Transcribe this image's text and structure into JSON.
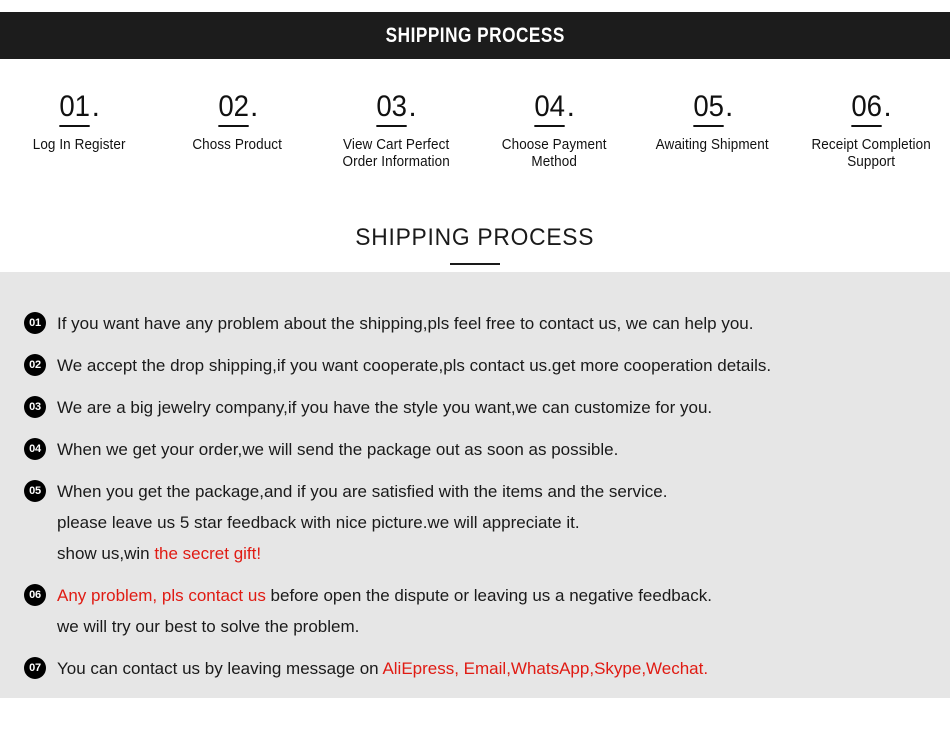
{
  "banner": {
    "title": "SHIPPING PROCESS"
  },
  "steps": [
    {
      "num": "01",
      "dot": ".",
      "label": "Log In Register"
    },
    {
      "num": "02",
      "dot": ".",
      "label": "Choss Product"
    },
    {
      "num": "03",
      "dot": ".",
      "label": "View Cart Perfect\nOrder Information"
    },
    {
      "num": "04",
      "dot": ".",
      "label": "Choose Payment\nMethod"
    },
    {
      "num": "05",
      "dot": ".",
      "label": "Awaiting Shipment"
    },
    {
      "num": "06",
      "dot": ".",
      "label": "Receipt Completion\nSupport"
    }
  ],
  "section": {
    "title": "SHIPPING PROCESS"
  },
  "colors": {
    "banner_bg": "#1c1c1c",
    "panel_bg": "#e6e6e6",
    "accent_red": "#e01b13",
    "badge_bg": "#000000",
    "text": "#1a1a1a"
  },
  "faq": [
    {
      "badge": "01",
      "lines": [
        [
          {
            "t": "If you want have any problem about the shipping,pls feel free to contact us, we can help you.",
            "c": "black"
          }
        ]
      ]
    },
    {
      "badge": "02",
      "lines": [
        [
          {
            "t": "We accept the drop shipping,if you want cooperate,pls contact us.get more cooperation details.",
            "c": "black"
          }
        ]
      ]
    },
    {
      "badge": "03",
      "lines": [
        [
          {
            "t": "We are a big jewelry company,if you have the style you want,we can customize for you.",
            "c": "black"
          }
        ]
      ]
    },
    {
      "badge": "04",
      "lines": [
        [
          {
            "t": "When we get your order,we will send the package out as soon as possible.",
            "c": "black"
          }
        ]
      ]
    },
    {
      "badge": "05",
      "lines": [
        [
          {
            "t": "When you get the package,and if you are satisfied with the items and the service.",
            "c": "black"
          }
        ],
        [
          {
            "t": "please leave us 5 star feedback with nice picture.we will appreciate it.",
            "c": "black"
          }
        ],
        [
          {
            "t": "show us,win ",
            "c": "black"
          },
          {
            "t": "the secret gift!",
            "c": "red"
          }
        ]
      ]
    },
    {
      "badge": "06",
      "lines": [
        [
          {
            "t": "Any problem, pls contact us",
            "c": "red"
          },
          {
            "t": " before open the dispute or leaving us a negative feedback.",
            "c": "black"
          }
        ],
        [
          {
            "t": "we will try our best to solve the problem.",
            "c": "black"
          }
        ]
      ]
    },
    {
      "badge": "07",
      "lines": [
        [
          {
            "t": "You can contact us by leaving message on ",
            "c": "black"
          },
          {
            "t": "AliEpress, Email,WhatsApp,Skype,Wechat.",
            "c": "red"
          }
        ]
      ]
    }
  ]
}
